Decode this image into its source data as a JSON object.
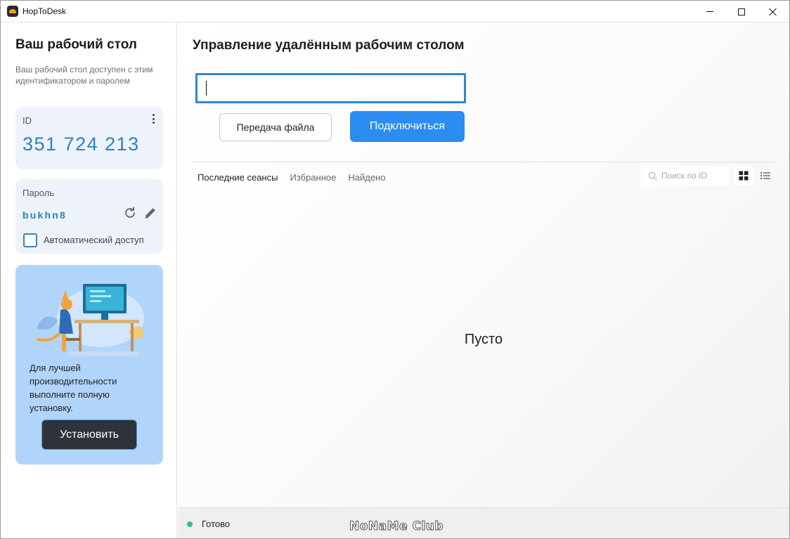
{
  "window": {
    "title": "HopToDesk"
  },
  "sidebar": {
    "title": "Ваш рабочий стол",
    "description": "Ваш рабочий стол доступен с этим идентификатором и паролем",
    "id_card": {
      "label": "ID",
      "value": "351 724 213"
    },
    "password_card": {
      "label": "Пароль",
      "value": "bukhn8",
      "auto_access_label": "Автоматический доступ",
      "auto_access_checked": false
    },
    "promo": {
      "text": "Для лучшей производительности выполните полную установку.",
      "install_label": "Установить"
    }
  },
  "main": {
    "title": "Управление удалённым рабочим столом",
    "id_input_value": "",
    "file_transfer_label": "Передача файла",
    "connect_label": "Подключиться",
    "tabs": [
      {
        "label": "Последние сеансы",
        "active": true
      },
      {
        "label": "Избранное",
        "active": false
      },
      {
        "label": "Найдено",
        "active": false
      }
    ],
    "search_placeholder": "Поиск по ID",
    "view_mode": "grid",
    "empty_text": "Пусто"
  },
  "statusbar": {
    "status": "Готово",
    "status_color": "#32c08a",
    "watermark": "NoNaMe Club"
  },
  "colors": {
    "accent": "#2b8cf2",
    "id_text": "#2f80c0",
    "promo_bg": "#b1d4fa"
  }
}
